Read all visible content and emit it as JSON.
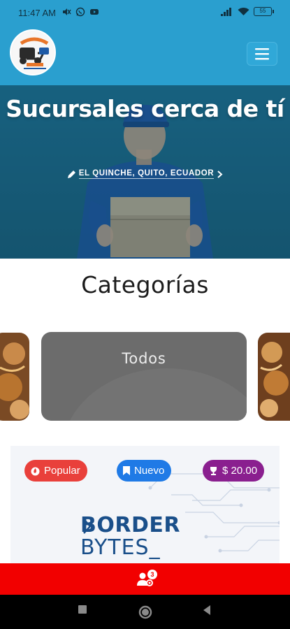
{
  "status_bar": {
    "time": "11:47 AM",
    "left_icons": [
      "mute-icon",
      "whatsapp-icon",
      "youtube-icon"
    ],
    "right_icons": [
      "signal-icon",
      "wifi-icon"
    ],
    "battery": "55"
  },
  "app_bar": {
    "logo_icon": "delivery-logo-icon",
    "menu_icon": "hamburger-menu-icon"
  },
  "hero": {
    "title": "Sucursales cerca de tí",
    "location": "EL QUINCHE, QUITO, ECUADOR",
    "location_icon": "pencil-icon",
    "location_chevron": "chevron-right-icon"
  },
  "categories": {
    "title": "Categorías",
    "active_label": "Todos"
  },
  "product": {
    "badges": [
      {
        "label": "Popular",
        "icon": "flame-icon",
        "color": "#e9403b"
      },
      {
        "label": "Nuevo",
        "icon": "bookmark-icon",
        "color": "#1f7ae6"
      },
      {
        "label": "$ 20.00",
        "icon": "trophy-icon",
        "color": "#8a1f8f"
      }
    ],
    "brand_line1": "BORDER",
    "brand_line2": "BYTES_"
  },
  "bottom_bar": {
    "icon": "users-gear-icon",
    "count": "3",
    "color": "#f20000"
  },
  "nav": {
    "buttons": [
      "recents-square-icon",
      "home-circle-icon",
      "back-triangle-icon"
    ]
  }
}
